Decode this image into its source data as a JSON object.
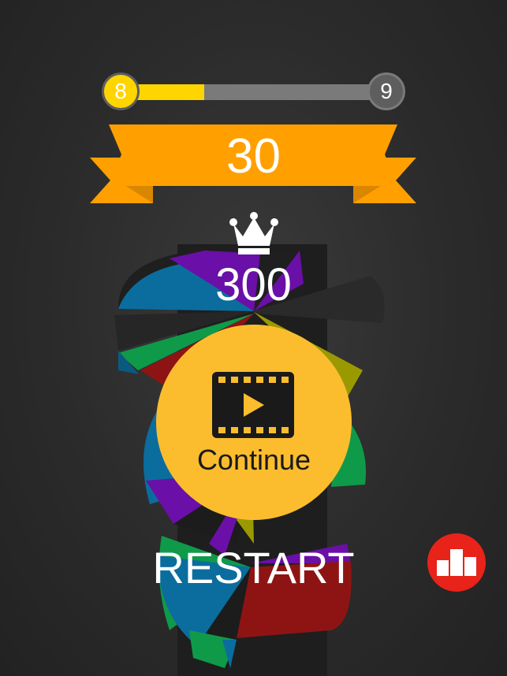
{
  "level": {
    "current": "8",
    "next": "9",
    "progress": 0.32
  },
  "score": "30",
  "best": {
    "value": "300",
    "icon": "crown-icon"
  },
  "continue_button": {
    "label": "Continue",
    "icon": "film-play-icon"
  },
  "restart_label": "RESTART",
  "leaderboard_button": {
    "icon": "podium-icon"
  },
  "colors": {
    "background": "#2b2b2b",
    "progress_fill": "#ffd500",
    "progress_track": "#7a7a7a",
    "next_level_circle": "#5e5e5e",
    "ribbon": "#ffa000",
    "ribbon_dark": "#d98600",
    "continue_button": "#fbbd2e",
    "leaderboard_button": "#e8231a",
    "helix_segments": [
      "#6a0fa8",
      "#0a6d9e",
      "#0f9a4a",
      "#8e1414",
      "#9a9a00",
      "#1c1c1c"
    ]
  }
}
